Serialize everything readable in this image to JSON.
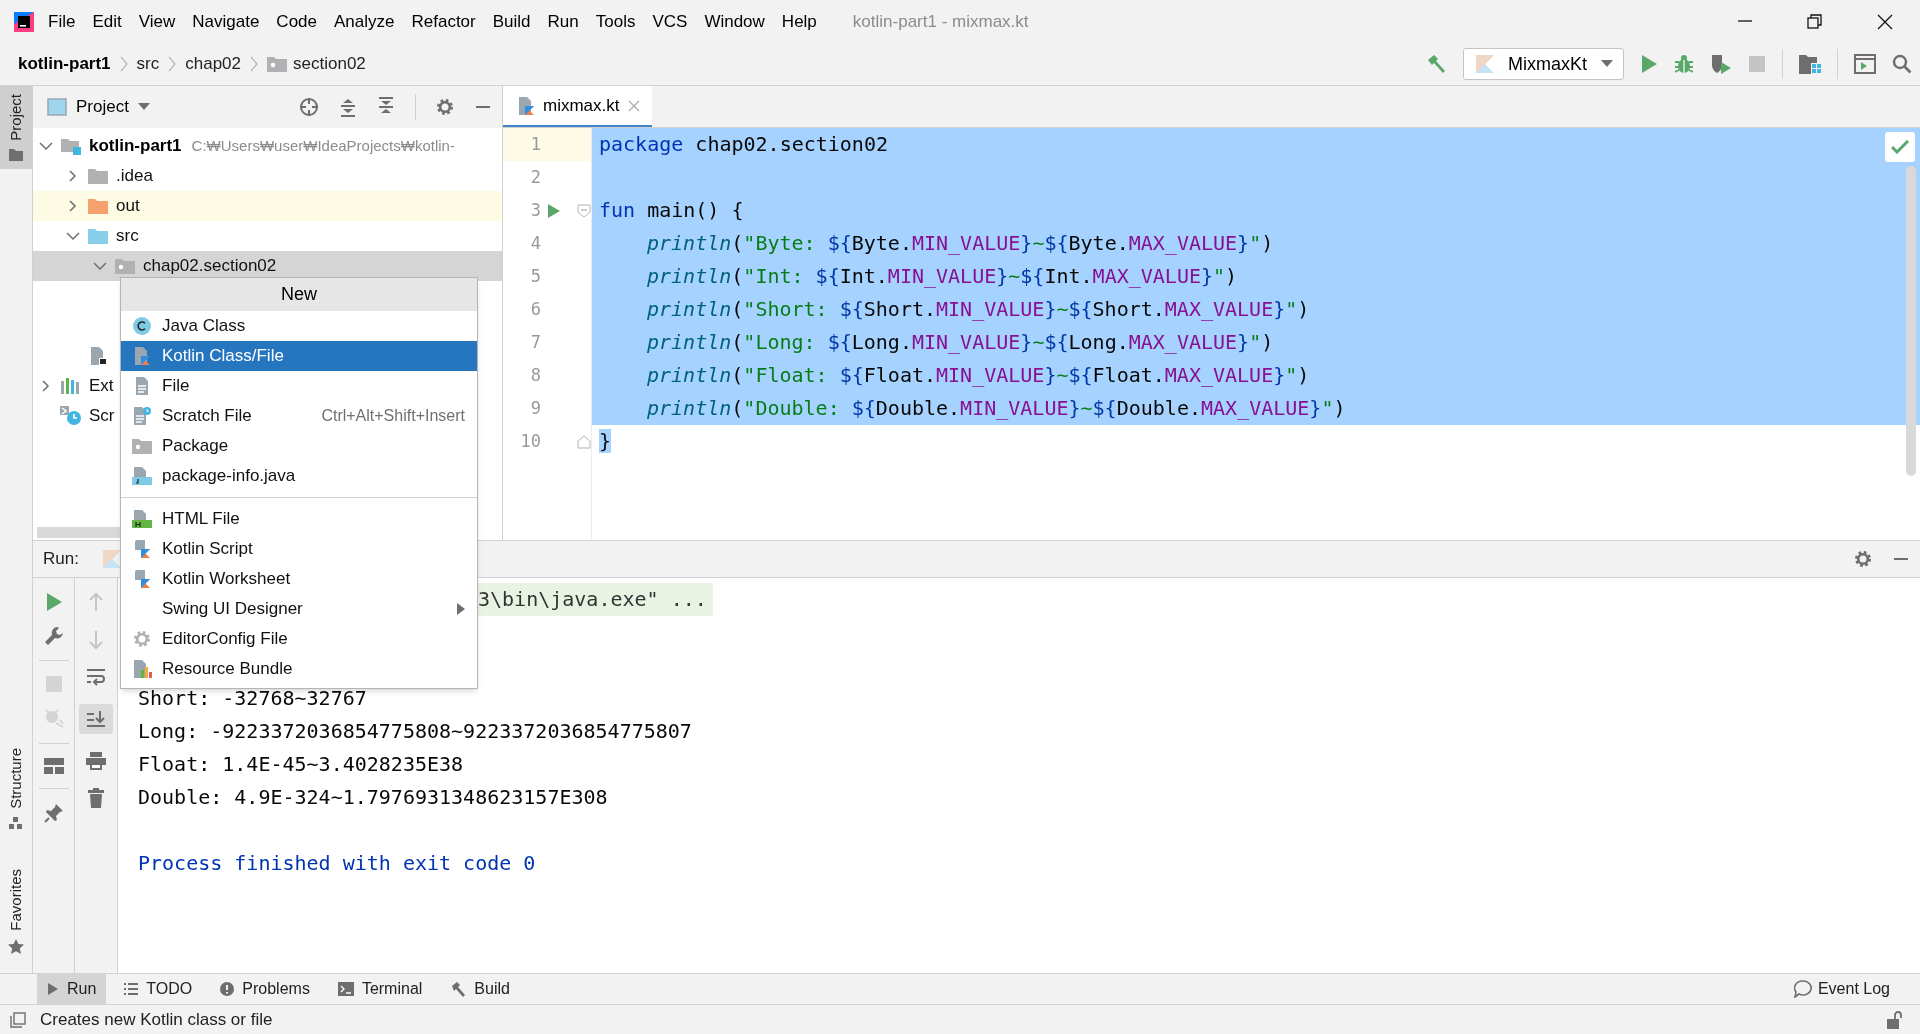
{
  "menu_bar": [
    "File",
    "Edit",
    "View",
    "Navigate",
    "Code",
    "Analyze",
    "Refactor",
    "Build",
    "Run",
    "Tools",
    "VCS",
    "Window",
    "Help"
  ],
  "window_title": "kotlin-part1 - mixmax.kt",
  "breadcrumbs": [
    {
      "label": "kotlin-part1",
      "kind": "project"
    },
    {
      "label": "src",
      "kind": "folder"
    },
    {
      "label": "chap02",
      "kind": "folder"
    },
    {
      "label": "section02",
      "kind": "package"
    }
  ],
  "run_configuration": "MixmaxKt",
  "side_tabs": [
    {
      "label": "Project",
      "kind": "project",
      "selected": true
    },
    {
      "label": "Structure",
      "kind": "structure",
      "selected": false
    },
    {
      "label": "Favorites",
      "kind": "favorites",
      "selected": false
    }
  ],
  "project_panel": {
    "title": "Project",
    "tree": [
      {
        "kind": "module",
        "label": "kotlin-part1",
        "path": "C:₩Users₩user₩IdeaProjects₩kotlin-",
        "expanded": true,
        "selected": false,
        "children": [
          {
            "kind": "folder",
            "label": ".idea",
            "expanded": false,
            "selected": false
          },
          {
            "kind": "excluded",
            "label": "out",
            "expanded": false,
            "selected": false
          },
          {
            "kind": "sources",
            "label": "src",
            "expanded": true,
            "selected": false,
            "children": [
              {
                "kind": "package",
                "label": "chap02.section02",
                "expanded": true,
                "selected": true
              }
            ]
          },
          {
            "kind": "module-file",
            "selected": false
          }
        ]
      },
      {
        "kind": "libraries",
        "label": "Ext",
        "expanded": false,
        "selected": false
      },
      {
        "kind": "scratches",
        "label": "Scr",
        "selected": false
      }
    ]
  },
  "editor": {
    "tabs": [
      {
        "label": "mixmax.kt",
        "selected": true
      }
    ],
    "lines": [
      {
        "number": "1",
        "current": true,
        "selected": true,
        "tokens": [
          {
            "kind": "keyword",
            "text": "package"
          },
          {
            "kind": "plain",
            "text": " chap02.section02"
          }
        ]
      },
      {
        "number": "2",
        "current": false,
        "selected": true
      },
      {
        "number": "3",
        "current": false,
        "selected": true,
        "run_marker": true,
        "fold_start": true,
        "tokens": [
          {
            "kind": "keyword",
            "text": "fun"
          },
          {
            "kind": "plain",
            "text": " main() {"
          }
        ],
        "children": [
          {
            "number": "4",
            "current": false,
            "selected": true,
            "tokens": [
              {
                "kind": "call",
                "text": "println"
              },
              {
                "kind": "plain",
                "text": "("
              },
              {
                "kind": "string",
                "text": "\"Byte: "
              },
              {
                "kind": "template",
                "text": "${"
              },
              {
                "kind": "plain",
                "text": "Byte."
              },
              {
                "kind": "constant",
                "text": "MIN_VALUE"
              },
              {
                "kind": "template",
                "text": "}"
              },
              {
                "kind": "string",
                "text": "~"
              },
              {
                "kind": "template",
                "text": "${"
              },
              {
                "kind": "plain",
                "text": "Byte."
              },
              {
                "kind": "constant",
                "text": "MAX_VALUE"
              },
              {
                "kind": "template",
                "text": "}"
              },
              {
                "kind": "string",
                "text": "\""
              },
              {
                "kind": "plain",
                "text": ")"
              }
            ]
          },
          {
            "number": "5",
            "current": false,
            "selected": true,
            "tokens": [
              {
                "kind": "call",
                "text": "println"
              },
              {
                "kind": "plain",
                "text": "("
              },
              {
                "kind": "string",
                "text": "\"Int: "
              },
              {
                "kind": "template",
                "text": "${"
              },
              {
                "kind": "plain",
                "text": "Int."
              },
              {
                "kind": "constant",
                "text": "MIN_VALUE"
              },
              {
                "kind": "template",
                "text": "}"
              },
              {
                "kind": "string",
                "text": "~"
              },
              {
                "kind": "template",
                "text": "${"
              },
              {
                "kind": "plain",
                "text": "Int."
              },
              {
                "kind": "constant",
                "text": "MAX_VALUE"
              },
              {
                "kind": "template",
                "text": "}"
              },
              {
                "kind": "string",
                "text": "\""
              },
              {
                "kind": "plain",
                "text": ")"
              }
            ]
          },
          {
            "number": "6",
            "current": false,
            "selected": true,
            "tokens": [
              {
                "kind": "call",
                "text": "println"
              },
              {
                "kind": "plain",
                "text": "("
              },
              {
                "kind": "string",
                "text": "\"Short: "
              },
              {
                "kind": "template",
                "text": "${"
              },
              {
                "kind": "plain",
                "text": "Short."
              },
              {
                "kind": "constant",
                "text": "MIN_VALUE"
              },
              {
                "kind": "template",
                "text": "}"
              },
              {
                "kind": "string",
                "text": "~"
              },
              {
                "kind": "template",
                "text": "${"
              },
              {
                "kind": "plain",
                "text": "Short."
              },
              {
                "kind": "constant",
                "text": "MAX_VALUE"
              },
              {
                "kind": "template",
                "text": "}"
              },
              {
                "kind": "string",
                "text": "\""
              },
              {
                "kind": "plain",
                "text": ")"
              }
            ]
          },
          {
            "number": "7",
            "current": false,
            "selected": true,
            "tokens": [
              {
                "kind": "call",
                "text": "println"
              },
              {
                "kind": "plain",
                "text": "("
              },
              {
                "kind": "string",
                "text": "\"Long: "
              },
              {
                "kind": "template",
                "text": "${"
              },
              {
                "kind": "plain",
                "text": "Long."
              },
              {
                "kind": "constant",
                "text": "MIN_VALUE"
              },
              {
                "kind": "template",
                "text": "}"
              },
              {
                "kind": "string",
                "text": "~"
              },
              {
                "kind": "template",
                "text": "${"
              },
              {
                "kind": "plain",
                "text": "Long."
              },
              {
                "kind": "constant",
                "text": "MAX_VALUE"
              },
              {
                "kind": "template",
                "text": "}"
              },
              {
                "kind": "string",
                "text": "\""
              },
              {
                "kind": "plain",
                "text": ")"
              }
            ]
          },
          {
            "number": "8",
            "current": false,
            "selected": true,
            "tokens": [
              {
                "kind": "call",
                "text": "println"
              },
              {
                "kind": "plain",
                "text": "("
              },
              {
                "kind": "string",
                "text": "\"Float: "
              },
              {
                "kind": "template",
                "text": "${"
              },
              {
                "kind": "plain",
                "text": "Float."
              },
              {
                "kind": "constant",
                "text": "MIN_VALUE"
              },
              {
                "kind": "template",
                "text": "}"
              },
              {
                "kind": "string",
                "text": "~"
              },
              {
                "kind": "template",
                "text": "${"
              },
              {
                "kind": "plain",
                "text": "Float."
              },
              {
                "kind": "constant",
                "text": "MAX_VALUE"
              },
              {
                "kind": "template",
                "text": "}"
              },
              {
                "kind": "string",
                "text": "\""
              },
              {
                "kind": "plain",
                "text": ")"
              }
            ]
          },
          {
            "number": "9",
            "current": false,
            "selected": true,
            "tokens": [
              {
                "kind": "call",
                "text": "println"
              },
              {
                "kind": "plain",
                "text": "("
              },
              {
                "kind": "string",
                "text": "\"Double: "
              },
              {
                "kind": "template",
                "text": "${"
              },
              {
                "kind": "plain",
                "text": "Double."
              },
              {
                "kind": "constant",
                "text": "MIN_VALUE"
              },
              {
                "kind": "template",
                "text": "}"
              },
              {
                "kind": "string",
                "text": "~"
              },
              {
                "kind": "template",
                "text": "${"
              },
              {
                "kind": "plain",
                "text": "Double."
              },
              {
                "kind": "constant",
                "text": "MAX_VALUE"
              },
              {
                "kind": "template",
                "text": "}"
              },
              {
                "kind": "string",
                "text": "\""
              },
              {
                "kind": "plain",
                "text": ")"
              }
            ]
          }
        ]
      },
      {
        "number": "10",
        "current": false,
        "selected": false,
        "fold_end": true,
        "tokens": [
          {
            "kind": "plain",
            "text": "}",
            "selected": true
          }
        ]
      }
    ]
  },
  "run_panel": {
    "title": "Run:",
    "console": [
      {
        "kind": "command",
        "text": "3\\bin\\java.exe\" ..."
      },
      {
        "kind": "output",
        "text": "Short: -32768~32767"
      },
      {
        "kind": "output",
        "text": "Long: -9223372036854775808~9223372036854775807"
      },
      {
        "kind": "output",
        "text": "Float: 1.4E-45~3.4028235E38"
      },
      {
        "kind": "output",
        "text": "Double: 4.9E-324~1.7976931348623157E308"
      },
      {
        "kind": "exit",
        "text": "Process finished with exit code 0"
      }
    ]
  },
  "context_menu": {
    "title": "New",
    "items": [
      {
        "kind": "java-class",
        "label": "Java Class",
        "selected": false
      },
      {
        "kind": "kotlin-class",
        "label": "Kotlin Class/File",
        "selected": true
      },
      {
        "kind": "file",
        "label": "File",
        "selected": false
      },
      {
        "kind": "scratch",
        "label": "Scratch File",
        "shortcut": "Ctrl+Alt+Shift+Insert",
        "selected": false
      },
      {
        "kind": "package",
        "label": "Package",
        "selected": false
      },
      {
        "kind": "package-info",
        "label": "package-info.java",
        "selected": false
      },
      {
        "kind": "separator"
      },
      {
        "kind": "html",
        "label": "HTML File",
        "selected": false
      },
      {
        "kind": "kotlin-script",
        "label": "Kotlin Script",
        "selected": false
      },
      {
        "kind": "kotlin-worksheet",
        "label": "Kotlin Worksheet",
        "selected": false
      },
      {
        "kind": "submenu",
        "label": "Swing UI Designer",
        "selected": false
      },
      {
        "kind": "editorconfig",
        "label": "EditorConfig File",
        "selected": false
      },
      {
        "kind": "bundle",
        "label": "Resource Bundle",
        "selected": false
      }
    ]
  },
  "tool_windows": [
    {
      "kind": "run",
      "label": "Run",
      "selected": true
    },
    {
      "kind": "todo",
      "label": "TODO",
      "selected": false
    },
    {
      "kind": "problems",
      "label": "Problems",
      "selected": false
    },
    {
      "kind": "terminal",
      "label": "Terminal",
      "selected": false
    },
    {
      "kind": "build",
      "label": "Build",
      "selected": false
    }
  ],
  "event_log": "Event Log",
  "status_message": "Creates new Kotlin class or file"
}
